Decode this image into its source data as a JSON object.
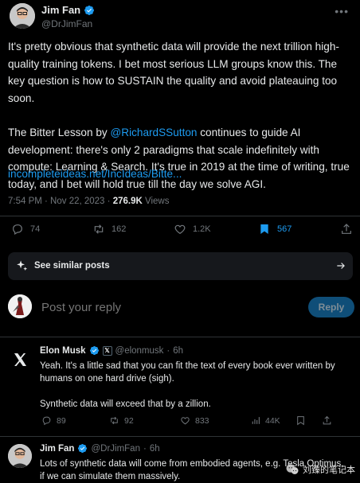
{
  "main_tweet": {
    "author_name": "Jim Fan",
    "author_handle": "@DrJimFan",
    "paragraph1": "It's pretty obvious that synthetic data will provide the next trillion high-quality training tokens. I bet most serious LLM groups know this. The key question is how to SUSTAIN the quality and avoid plateauing too soon.",
    "paragraph2_before": "The Bitter Lesson by ",
    "paragraph2_mention": "@RichardSSutton",
    "paragraph2_after": " continues to guide AI development: there's only 2 paradigms that scale indefinitely with compute: Learning & Search. It's true in 2019 at the time of writing, true today, and I bet will hold true till the day we solve AGI.",
    "link": "incompleteideas.net/IncIdeas/Bitte...",
    "timestamp": "7:54 PM · Nov 22, 2023 · ",
    "views_count": "276.9K",
    "views_label": " Views",
    "stats": {
      "replies": "74",
      "reposts": "162",
      "likes": "1.2K",
      "bookmarks": "567"
    }
  },
  "similar_posts": {
    "label": "See similar posts"
  },
  "reply_composer": {
    "placeholder": "Post your reply",
    "button_label": "Reply"
  },
  "replies": [
    {
      "author_name": "Elon Musk",
      "author_handle": "@elonmusk",
      "time": "6h",
      "affiliate_badge": "𝕏",
      "paragraph1": "Yeah. It's a little sad that you can fit the text of every book ever written by humans on one hard drive (sigh).",
      "paragraph2": "Synthetic data will exceed that by a zillion.",
      "stats": {
        "replies": "89",
        "reposts": "92",
        "likes": "833",
        "views": "44K"
      }
    },
    {
      "author_name": "Jim Fan",
      "author_handle": "@DrJimFan",
      "time": "6h",
      "paragraph1": "Lots of synthetic data will come from embodied agents, e.g. Tesla Optimus, if we can simulate them massively."
    }
  ],
  "watermark": {
    "text": "刘臻的笔记本"
  },
  "colors": {
    "background": "#000000",
    "text": "#e7e9ea",
    "muted": "#71767b",
    "accent": "#1d9bf0",
    "divider": "#2f3336"
  },
  "icons": [
    "verified-badge-icon",
    "more-options-icon",
    "reply-icon",
    "repost-icon",
    "like-icon",
    "bookmark-icon",
    "share-icon",
    "sparkle-icon",
    "arrow-right-icon",
    "x-logo-icon",
    "views-icon"
  ]
}
